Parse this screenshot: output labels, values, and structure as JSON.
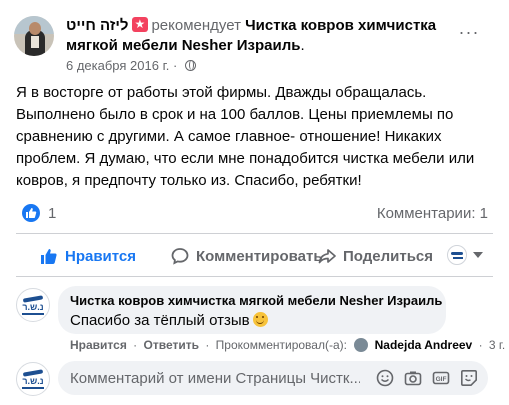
{
  "post": {
    "author": "ליזה חייט",
    "recommends": "рекомендует",
    "page_name_line1": "Чистка ковров химчистка",
    "page_name_line2": "мягкой мебели Nesher Израиль",
    "page_name_suffix": ".",
    "date": "6 декабря 2016 г.",
    "date_separator": "·",
    "text": "Я в восторге от работы  этой фирмы.  Дважды обращалась.\nВыполнено было в срок и на 100 баллов.  Цены приемлемы по\nсравнению с другими.  А самое главное- отношение!  Никаких\nпроблем.  Я думаю,  что если мне понадобится чистка мебели или\nковров,  я предпочту  только из.  Спасибо,  ребятки!",
    "more_label": "···"
  },
  "summary": {
    "reactions_count": "1",
    "comments_count": "Комментарии: 1"
  },
  "actions": {
    "like": "Нравится",
    "comment": "Комментировать",
    "share": "Поделиться"
  },
  "comment": {
    "author": "Чистка ковров химчистка мягкой мебели Nesher Израиль",
    "text": "Спасибо за тёплый отзыв",
    "like": "Нравится",
    "reply": "Ответить",
    "commented_by": "Прокомментировал(-а):",
    "commenter": "Nadejda Andreev",
    "time": "3 г.",
    "separator": "·",
    "logo_text": "נ.ש.ר"
  },
  "composer": {
    "placeholder": "Комментарий от имени Страницы Чистк..."
  },
  "colors": {
    "accent": "#1877f2",
    "muted": "#65676b",
    "bubble": "#f0f2f5",
    "recommend_badge": "#f3425f"
  },
  "icons": {
    "more": "ellipsis-icon",
    "privacy": "globe-icon",
    "like": "thumbs-up-icon",
    "comment": "speech-bubble-icon",
    "share": "share-arrow-icon",
    "emoji": "smiley-icon",
    "camera": "camera-icon",
    "gif": "gif-icon",
    "sticker": "sticker-icon"
  }
}
